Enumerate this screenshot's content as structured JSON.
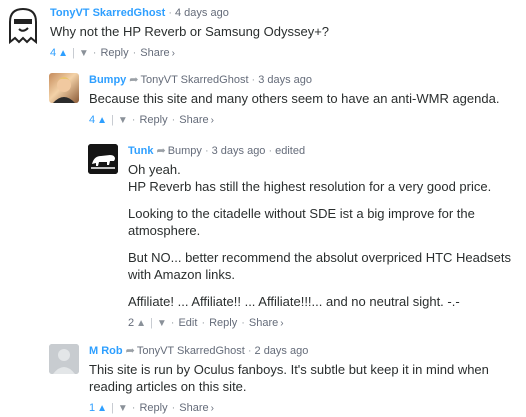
{
  "comments": [
    {
      "author": "TonyVT SkarredGhost",
      "reply_to": "",
      "time": "4 days ago",
      "edited": "",
      "paragraphs": [
        "Why not the HP Reverb or Samsung Odyssey+?"
      ],
      "votes": "4",
      "actions": [
        "Reply",
        "Share"
      ],
      "avatar_icon": "ghost-avatar"
    },
    {
      "author": "Bumpy",
      "reply_to": "TonyVT SkarredGhost",
      "time": "3 days ago",
      "edited": "",
      "paragraphs": [
        "Because this site and many others seem to have an anti-WMR agenda."
      ],
      "votes": "4",
      "actions": [
        "Reply",
        "Share"
      ],
      "avatar_icon": "photo-avatar"
    },
    {
      "author": "Tunk",
      "reply_to": "Bumpy",
      "time": "3 days ago",
      "edited": "edited",
      "paragraphs": [
        "Oh yeah.\nHP Reverb has still the highest resolution for a very good price.",
        "Looking to the citadelle without SDE ist a big improve for the atmosphere.",
        "But NO... better recommend the absolut overpriced HTC Headsets with Amazon links.",
        "Affiliate! ... Affiliate!! ... Affiliate!!!... and no neutral sight. -.-"
      ],
      "votes": "2",
      "actions": [
        "Edit",
        "Reply",
        "Share"
      ],
      "avatar_icon": "bear-avatar"
    },
    {
      "author": "M Rob",
      "reply_to": "TonyVT SkarredGhost",
      "time": "2 days ago",
      "edited": "",
      "paragraphs": [
        "This site is run by Oculus fanboys. It's subtle but keep it in mind when reading articles on this site."
      ],
      "votes": "1",
      "actions": [
        "Reply",
        "Share"
      ],
      "avatar_icon": "default-avatar"
    }
  ],
  "colors": {
    "accent": "#2e9fff",
    "meta": "#656c7a",
    "text": "#2a2e2e"
  }
}
